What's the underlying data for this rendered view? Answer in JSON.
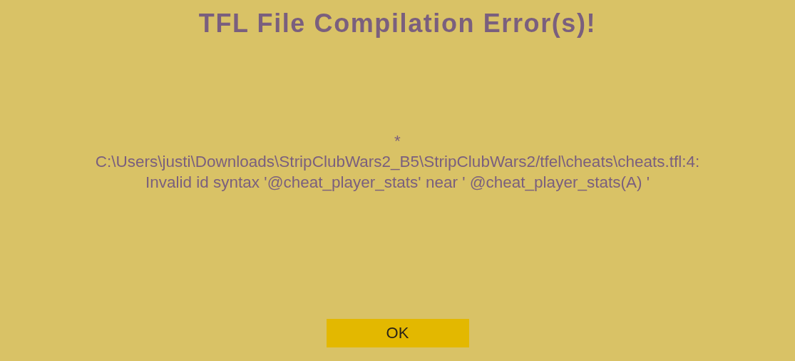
{
  "title": "TFL File Compilation Error(s)!",
  "message": "*\nC:\\Users\\justi\\Downloads\\StripClubWars2_B5\\StripClubWars2/tfel\\cheats\\cheats.tfl:4:\nInvalid id syntax '@cheat_player_stats' near ' @cheat_player_stats(A) '",
  "buttons": [
    "OK"
  ]
}
